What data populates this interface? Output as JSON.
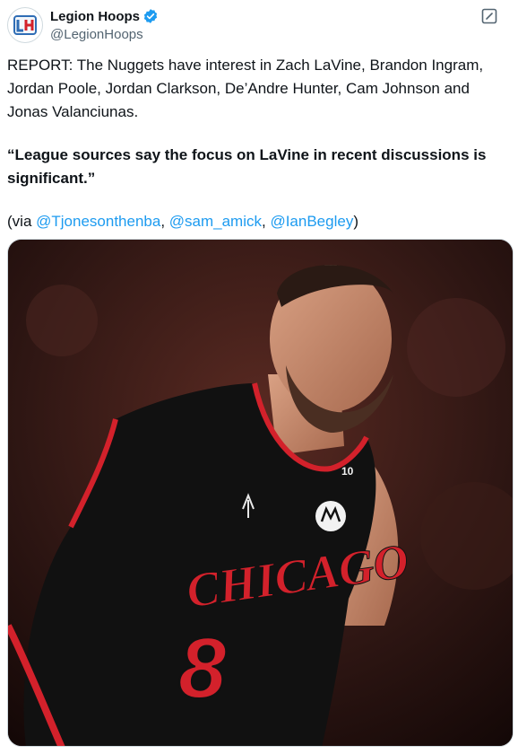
{
  "author": {
    "display_name": "Legion Hoops",
    "handle": "@LegionHoops",
    "avatar_icon": "legion-hoops-logo-icon",
    "verified_icon": "verified-badge-icon",
    "verified_color": "#1d9bf0"
  },
  "actions": {
    "edit_icon": "edit-icon"
  },
  "tweet": {
    "line1": "REPORT: The Nuggets have interest in Zach LaVine, Brandon Ingram, Jordan Poole, Jordan Clarkson, De’Andre Hunter, Cam Johnson and Jonas Valanciunas.",
    "quote": "“League sources say the focus on LaVine in recent discussions is significant.”",
    "via_prefix": "(via ",
    "mention1": "@Tjonesonthenba",
    "sep1": ", ",
    "mention2": "@sam_amick",
    "sep2": ", ",
    "mention3": "@IanBegley",
    "via_suffix": ")"
  },
  "media": {
    "jersey_text": "CHICAGO",
    "jersey_number": "8",
    "strap_number": "10",
    "colors": {
      "jersey": "#111111",
      "trim": "#d3212b",
      "skin": "#c98a6b",
      "background": "#3a1c18"
    }
  },
  "colors": {
    "text": "#0f1419",
    "secondary": "#536471",
    "link": "#1d9bf0"
  }
}
